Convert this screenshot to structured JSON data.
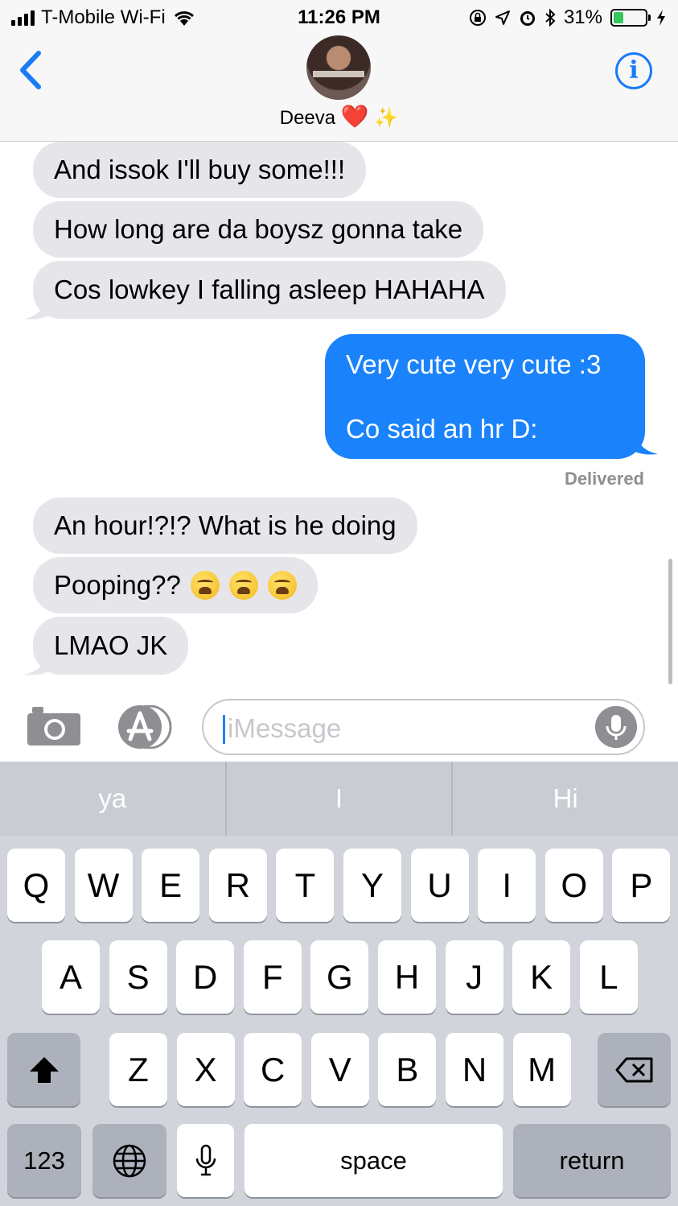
{
  "status_bar": {
    "carrier": "T-Mobile Wi-Fi",
    "time": "11:26 PM",
    "battery": "31%",
    "battery_level": 0.31
  },
  "header": {
    "contact_name": "Deeva",
    "heart_emoji": "❤️",
    "sparkle_emoji": "✨",
    "info_label": "i"
  },
  "messages": [
    {
      "direction": "incoming",
      "text": "And issok I'll buy some!!!"
    },
    {
      "direction": "incoming",
      "text": "How long are da boysz gonna take"
    },
    {
      "direction": "incoming",
      "text": "Cos lowkey I falling asleep HAHAHA"
    },
    {
      "direction": "outgoing",
      "lines": [
        "Very cute very cute :3",
        "Co said an hr D:"
      ]
    },
    {
      "direction": "incoming",
      "text": "An hour!?!? What is he doing"
    },
    {
      "direction": "incoming",
      "text": "Pooping??",
      "emoji": [
        "😩",
        "😩",
        "😩"
      ]
    },
    {
      "direction": "incoming",
      "text": "LMAO JK"
    }
  ],
  "delivered_label": "Delivered",
  "composer": {
    "placeholder": "iMessage"
  },
  "keyboard": {
    "suggestions": [
      "ya",
      "I",
      "Hi"
    ],
    "row1": [
      "Q",
      "W",
      "E",
      "R",
      "T",
      "Y",
      "U",
      "I",
      "O",
      "P"
    ],
    "row2": [
      "A",
      "S",
      "D",
      "F",
      "G",
      "H",
      "J",
      "K",
      "L"
    ],
    "row3": [
      "Z",
      "X",
      "C",
      "V",
      "B",
      "N",
      "M"
    ],
    "numbers_label": "123",
    "space_label": "space",
    "return_label": "return"
  },
  "colors": {
    "incoming_bubble": "#e5e5ea",
    "outgoing_bubble": "#1a82fb",
    "accent": "#1a7cf5"
  }
}
